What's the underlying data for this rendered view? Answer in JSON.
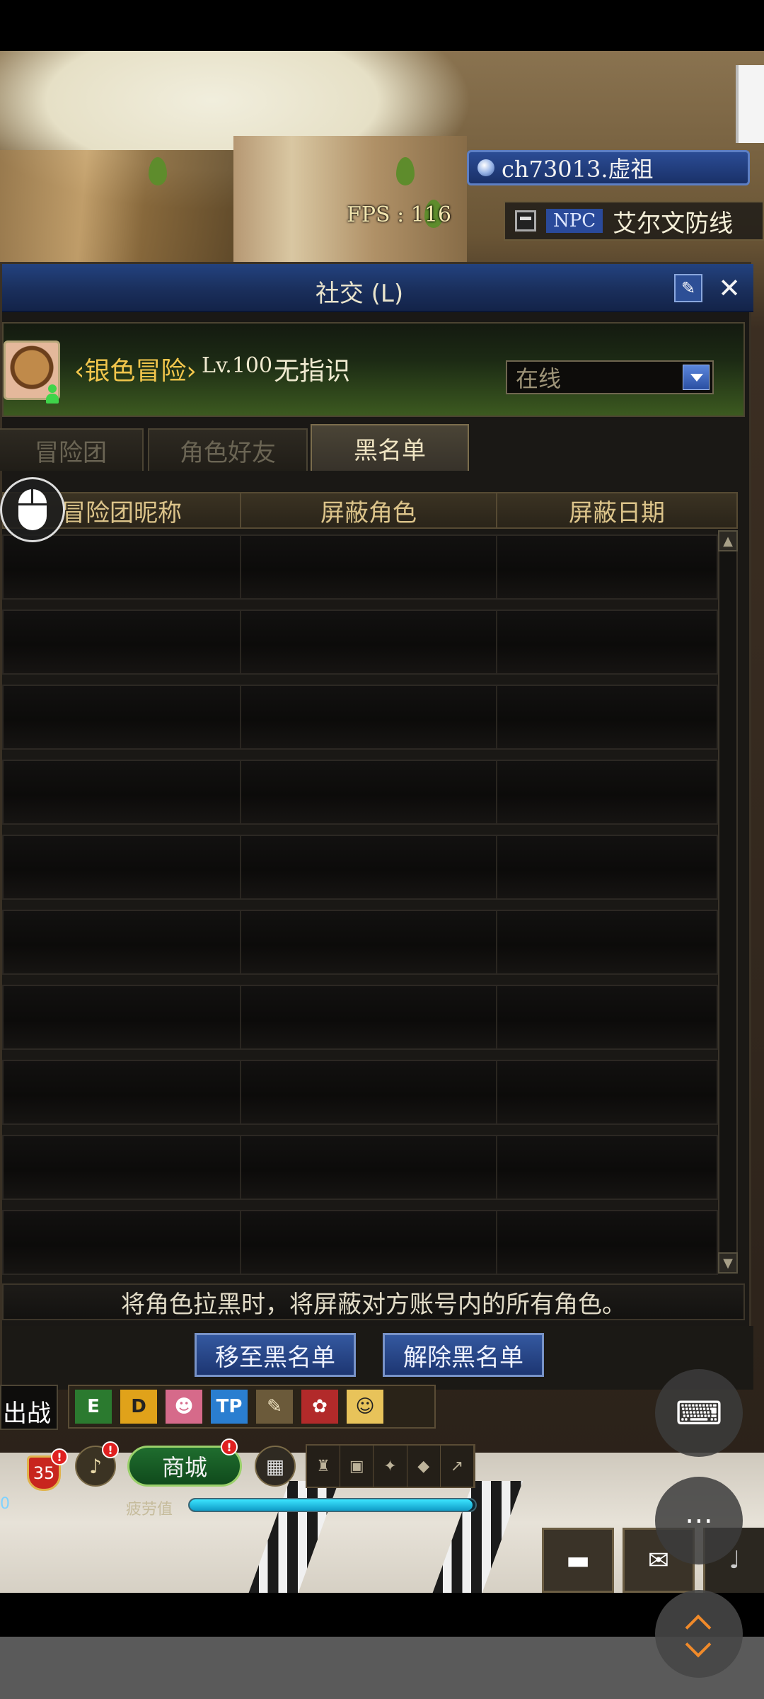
{
  "hud_top": {
    "channel": "ch73013.虚祖",
    "fps": "FPS : 116",
    "npc_tag": "NPC",
    "npc_name": "艾尔文防线"
  },
  "social_window": {
    "title": "社交 (L)",
    "profile": {
      "name": "‹银色冒险›",
      "level": "Lv.100",
      "guild": "无指识",
      "status_selected": "在线"
    },
    "tabs": [
      {
        "label": "冒险团",
        "active": false
      },
      {
        "label": "角色好友",
        "active": false
      },
      {
        "label": "黑名单",
        "active": true
      }
    ],
    "columns": [
      "冒险团昵称",
      "屏蔽角色",
      "屏蔽日期"
    ],
    "row_count": 10,
    "notice": "将角色拉黑时，将屏蔽对方账号内的所有角色。",
    "buttons": {
      "add": "移至黑名单",
      "remove": "解除黑名单"
    }
  },
  "hud_bottom": {
    "battle_label": "出战",
    "slots": [
      "E",
      "D",
      "☻",
      "TP",
      "✎",
      "✿",
      "☺"
    ],
    "level_badge": "35",
    "shop_label": "商城",
    "fatigue_label": "疲劳值",
    "fatigue_fraction": 0.99,
    "left_value": "0"
  },
  "colors": {
    "accent_blue": "#1d3672",
    "gold_text": "#f2c64c",
    "fatigue": "#3be5ff"
  }
}
